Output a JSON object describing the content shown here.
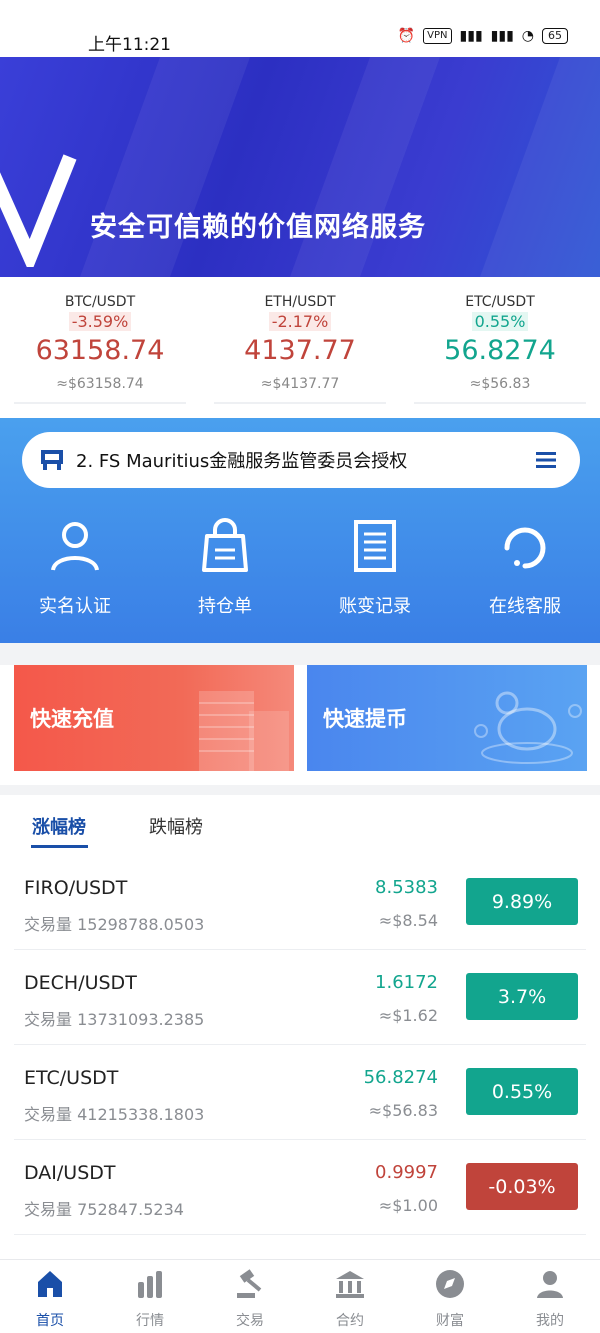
{
  "status_bar": {
    "time": "上午11:21",
    "vpn": "VPN",
    "battery": "65"
  },
  "banner": {
    "title": "安全可信赖的价值网络服务"
  },
  "tickers": [
    {
      "pair": "BTC/USDT",
      "change": "-3.59%",
      "price": "63158.74",
      "usd": "≈$63158.74",
      "trend": "down"
    },
    {
      "pair": "ETH/USDT",
      "change": "-2.17%",
      "price": "4137.77",
      "usd": "≈$4137.77",
      "trend": "down"
    },
    {
      "pair": "ETC/USDT",
      "change": "0.55%",
      "price": "56.8274",
      "usd": "≈$56.83",
      "trend": "up"
    }
  ],
  "notice": {
    "text": "2. FS Mauritius金融服务监管委员会授权"
  },
  "quick_links": [
    {
      "label": "实名认证",
      "icon": "user-icon"
    },
    {
      "label": "持仓单",
      "icon": "bag-icon"
    },
    {
      "label": "账变记录",
      "icon": "document-icon"
    },
    {
      "label": "在线客服",
      "icon": "support-icon"
    }
  ],
  "actions": {
    "deposit": "快速充值",
    "withdraw": "快速提币"
  },
  "tabs": {
    "gainers": "涨幅榜",
    "losers": "跌幅榜"
  },
  "market": [
    {
      "pair": "FIRO/USDT",
      "volume": "交易量 15298788.0503",
      "price": "8.5383",
      "usd": "≈$8.54",
      "change": "9.89%",
      "trend": "up"
    },
    {
      "pair": "DECH/USDT",
      "volume": "交易量 13731093.2385",
      "price": "1.6172",
      "usd": "≈$1.62",
      "change": "3.7%",
      "trend": "up"
    },
    {
      "pair": "ETC/USDT",
      "volume": "交易量 41215338.1803",
      "price": "56.8274",
      "usd": "≈$56.83",
      "change": "0.55%",
      "trend": "up"
    },
    {
      "pair": "DAI/USDT",
      "volume": "交易量 752847.5234",
      "price": "0.9997",
      "usd": "≈$1.00",
      "change": "-0.03%",
      "trend": "down"
    }
  ],
  "nav": [
    {
      "label": "首页",
      "icon": "home-icon",
      "active": true
    },
    {
      "label": "行情",
      "icon": "market-icon",
      "active": false
    },
    {
      "label": "交易",
      "icon": "trade-icon",
      "active": false
    },
    {
      "label": "合约",
      "icon": "contract-icon",
      "active": false
    },
    {
      "label": "财富",
      "icon": "wealth-icon",
      "active": false
    },
    {
      "label": "我的",
      "icon": "profile-icon",
      "active": false
    }
  ],
  "colors": {
    "up": "#12a58e",
    "down": "#c0443b",
    "primary": "#1a4fa8",
    "panel_blue": "#3a7fe6"
  }
}
